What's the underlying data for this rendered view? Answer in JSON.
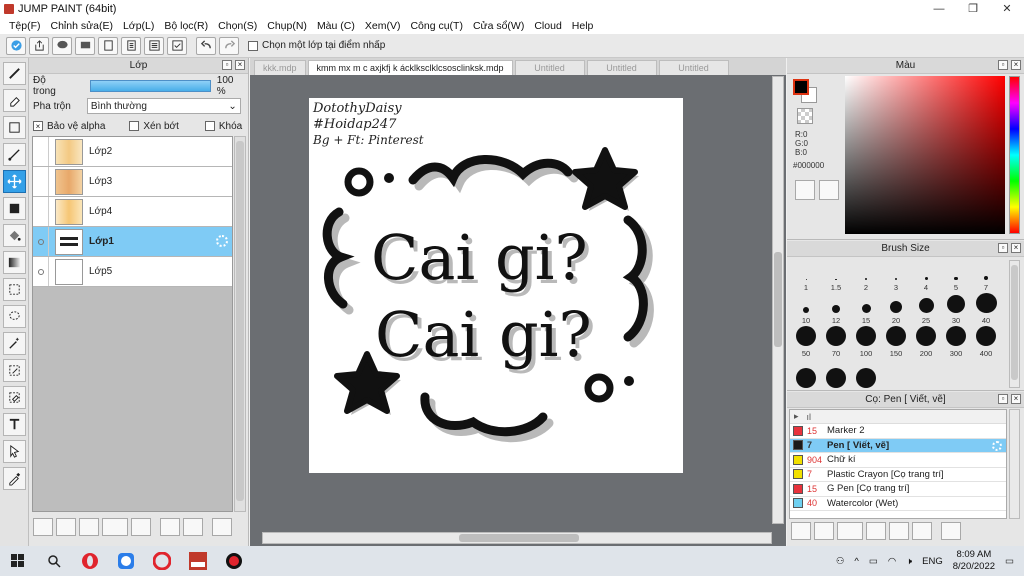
{
  "window": {
    "title": "JUMP PAINT (64bit)",
    "controls": [
      "—",
      "❐",
      "✕"
    ]
  },
  "menu": [
    "Tệp(F)",
    "Chỉnh sửa(E)",
    "Lớp(L)",
    "Bộ lọc(R)",
    "Chọn(S)",
    "Chụp(N)",
    "Màu (C)",
    "Xem(V)",
    "Công cụ(T)",
    "Cửa sổ(W)",
    "Cloud",
    "Help"
  ],
  "toolbar": {
    "select_layer_label": "Chọn một lớp tại điểm nhấp"
  },
  "layer_panel": {
    "title": "Lớp",
    "opacity_label": "Độ trong",
    "opacity_value": "100 %",
    "opacity_fraction": 1.0,
    "blend_label": "Pha trộn",
    "blend_value": "Bình thường",
    "protect_alpha": "Bảo vệ alpha",
    "clip": "Xén bớt",
    "lock": "Khóa",
    "layers": [
      {
        "name": "Lớp2",
        "selected": false
      },
      {
        "name": "Lớp3",
        "selected": false
      },
      {
        "name": "Lớp4",
        "selected": false
      },
      {
        "name": "Lớp1",
        "selected": true
      },
      {
        "name": "Lớp5",
        "selected": false
      }
    ]
  },
  "tabs": [
    "kkk.mdp",
    "kmm mx m c axjkfj k ácklksclklcsosclinksk.mdp",
    "Untitled",
    "Untitled",
    "Untitled"
  ],
  "active_tab": 1,
  "canvas": {
    "credit_lines": [
      "DotothyDaisy",
      "#Hoidap247",
      "Bg + Ft: Pinterest"
    ],
    "main_lines": [
      "Cai gi?",
      "Cai gi?"
    ]
  },
  "color_panel": {
    "title": "Màu",
    "r": "R:0",
    "g": "G:0",
    "b": "B:0",
    "hex": "#000000"
  },
  "brush_panel": {
    "title": "Brush Size",
    "sizes": [
      "1",
      "1.5",
      "2",
      "3",
      "4",
      "5",
      "7",
      "10",
      "12",
      "15",
      "20",
      "25",
      "30",
      "40",
      "50",
      "70",
      "100",
      "150",
      "200",
      "300",
      "400",
      "",
      "",
      ""
    ]
  },
  "tool_panel": {
    "title": "Cọ: Pen [ Viết, vẽ]",
    "header": "ıl",
    "items": [
      {
        "size": "15",
        "name": "Marker 2",
        "color": "#e8323c",
        "selected": false
      },
      {
        "size": "7",
        "name": "Pen [ Viết, vẽ]",
        "color": "#1a1a1a",
        "selected": true
      },
      {
        "size": "904",
        "name": "Chữ kí",
        "color": "#f2e000",
        "selected": false
      },
      {
        "size": "7",
        "name": "Plastic Crayon [Cọ trang trí]",
        "color": "#f2e000",
        "selected": false
      },
      {
        "size": "15",
        "name": "G Pen [Cọ trang trí]",
        "color": "#e8323c",
        "selected": false
      },
      {
        "size": "40",
        "name": "Watercolor (Wet)",
        "color": "#6fd0f0",
        "selected": false
      }
    ]
  },
  "taskbar": {
    "lang": "ENG",
    "time": "8:09 AM",
    "date": "8/20/2022"
  }
}
